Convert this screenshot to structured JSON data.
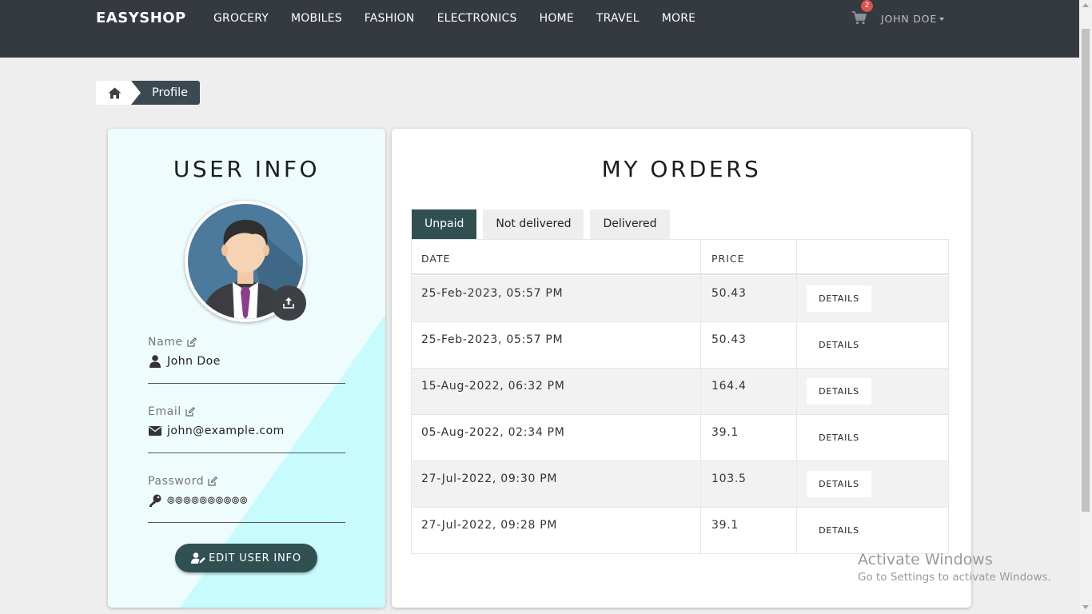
{
  "navbar": {
    "brand": "EASYSHOP",
    "links": [
      "GROCERY",
      "MOBILES",
      "FASHION",
      "ELECTRONICS",
      "HOME",
      "TRAVEL",
      "MORE"
    ],
    "cart_count": "2",
    "user_name": "JOHN DOE",
    "cart_icon": "shopping-cart-icon"
  },
  "breadcrumb": {
    "home_icon": "home-icon",
    "current": "Profile"
  },
  "user_info": {
    "title": "USER INFO",
    "name_label": "Name",
    "name_value": "John Doe",
    "email_label": "Email",
    "email_value": "john@example.com",
    "password_label": "Password",
    "password_value": "⦾⦾⦾⦾⦾⦾⦾⦾⦾⦾",
    "edit_button": "EDIT USER INFO"
  },
  "orders": {
    "title": "MY ORDERS",
    "tabs": [
      "Unpaid",
      "Not delivered",
      "Delivered"
    ],
    "active_tab": "Unpaid",
    "columns": [
      "DATE",
      "PRICE",
      ""
    ],
    "rows": [
      {
        "date": "25-Feb-2023, 05:57 PM",
        "price": "50.43",
        "action": "DETAILS"
      },
      {
        "date": "25-Feb-2023, 05:57 PM",
        "price": "50.43",
        "action": "DETAILS"
      },
      {
        "date": "15-Aug-2022, 06:32 PM",
        "price": "164.4",
        "action": "DETAILS"
      },
      {
        "date": "05-Aug-2022, 02:34 PM",
        "price": "39.1",
        "action": "DETAILS"
      },
      {
        "date": "27-Jul-2022, 09:30 PM",
        "price": "103.5",
        "action": "DETAILS"
      },
      {
        "date": "27-Jul-2022, 09:28 PM",
        "price": "39.1",
        "action": "DETAILS"
      }
    ]
  },
  "watermark": {
    "line1": "Activate Windows",
    "line2": "Go to Settings to activate Windows."
  },
  "colors": {
    "navbar": "#343a40",
    "accent": "#305052",
    "badge": "#d9534f",
    "user_card_bg": "#effcfd",
    "user_card_diag": "#c8fbfe"
  }
}
